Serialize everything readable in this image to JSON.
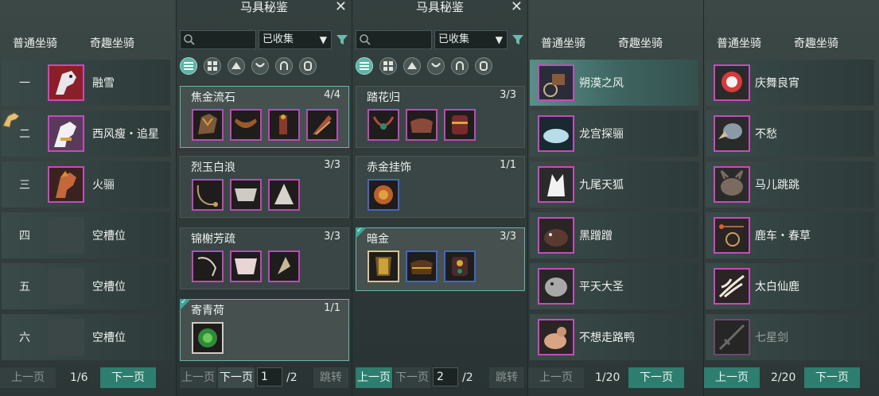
{
  "tabs": {
    "normal": "普通坐骑",
    "fun": "奇趣坐骑"
  },
  "panel1": {
    "rows": [
      {
        "rank": "一",
        "name": "融雪",
        "empty": false
      },
      {
        "rank": "二",
        "name": "西风瘦・追星",
        "empty": false
      },
      {
        "rank": "三",
        "name": "火骊",
        "empty": false
      },
      {
        "rank": "四",
        "name": "空槽位",
        "empty": true
      },
      {
        "rank": "五",
        "name": "空槽位",
        "empty": true
      },
      {
        "rank": "六",
        "name": "空槽位",
        "empty": true
      }
    ],
    "pager": {
      "prev": "上一页",
      "page": "1/6",
      "next": "下一页"
    }
  },
  "codex": {
    "title": "马具秘鉴",
    "filter": "已收集",
    "pager": {
      "prev": "上一页",
      "next": "下一页",
      "jump": "跳转"
    }
  },
  "panel2": {
    "sets": [
      {
        "name": "焦金流石",
        "count": "4/4"
      },
      {
        "name": "烈玉白浪",
        "count": "3/3"
      },
      {
        "name": "锦榭芳疏",
        "count": "3/3"
      },
      {
        "name": "寄青荷",
        "count": "1/1"
      }
    ],
    "page_input": "1",
    "page_total": "/2"
  },
  "panel3": {
    "sets": [
      {
        "name": "踏花归",
        "count": "3/3"
      },
      {
        "name": "赤金挂饰",
        "count": "1/1"
      },
      {
        "name": "暗金",
        "count": "3/3"
      }
    ],
    "page_input": "2",
    "page_total": "/2"
  },
  "panel4": {
    "rows": [
      {
        "name": "朔漠之风"
      },
      {
        "name": "龙宫探骊"
      },
      {
        "name": "九尾天狐"
      },
      {
        "name": "黑蹭蹭"
      },
      {
        "name": "平天大圣"
      },
      {
        "name": "不想走路鸭"
      }
    ],
    "pager": {
      "prev": "上一页",
      "page": "1/20",
      "next": "下一页"
    }
  },
  "panel5": {
    "rows": [
      {
        "name": "庆舞良宵"
      },
      {
        "name": "不愁"
      },
      {
        "name": "马儿跳跳"
      },
      {
        "name": "鹿车・春草"
      },
      {
        "name": "太白仙鹿"
      },
      {
        "name": "七星剑"
      }
    ],
    "pager": {
      "prev": "上一页",
      "page": "2/20",
      "next": "下一页"
    }
  },
  "colors": {
    "accent": "#2d7e6f",
    "rarity_purple": "#c54bbf",
    "rarity_blue": "#4466c2"
  }
}
